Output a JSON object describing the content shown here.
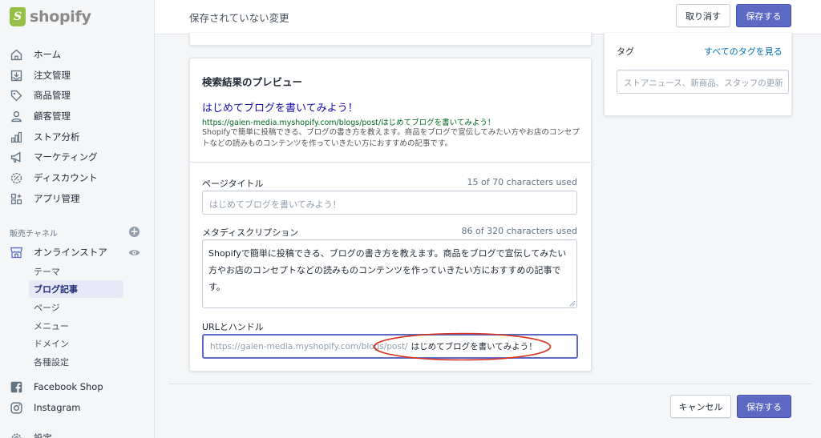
{
  "brand": {
    "name": "shopify",
    "mark": "S",
    "logo_color": "#95bf47"
  },
  "sidebar": {
    "items": [
      {
        "label": "ホーム",
        "icon": "home-icon"
      },
      {
        "label": "注文管理",
        "icon": "inbox-icon"
      },
      {
        "label": "商品管理",
        "icon": "tag-icon"
      },
      {
        "label": "顧客管理",
        "icon": "person-icon"
      },
      {
        "label": "ストア分析",
        "icon": "bar-chart-icon"
      },
      {
        "label": "マーケティング",
        "icon": "megaphone-icon"
      },
      {
        "label": "ディスカウント",
        "icon": "discount-icon"
      },
      {
        "label": "アプリ管理",
        "icon": "apps-icon"
      }
    ],
    "sales_channels_label": "販売チャネル",
    "online_store": {
      "label": "オンラインストア",
      "icon": "store-icon"
    },
    "online_store_subitems": [
      "テーマ",
      "ブログ記事",
      "ページ",
      "メニュー",
      "ドメイン",
      "各種設定"
    ],
    "active_subitem": "ブログ記事",
    "channels": [
      {
        "label": "Facebook Shop",
        "icon": "facebook-icon"
      },
      {
        "label": "Instagram",
        "icon": "instagram-icon"
      }
    ],
    "settings_partial": "設定"
  },
  "topbar": {
    "status": "保存されていない変更",
    "discard_label": "取り消す",
    "save_label": "保存する"
  },
  "seo": {
    "heading": "検索結果のプレビュー",
    "preview_title": "はじめてブログを書いてみよう！",
    "preview_url": "https://gaien-media.myshopify.com/blogs/post/はじめてブログを書いてみよう！",
    "preview_description": "Shopifyで簡単に投稿できる、ブログの書き方を教えます。商品をブログで宣伝してみたい方やお店のコンセプトなどの読みものコンテンツを作っていきたい方におすすめの記事です。",
    "page_title_label": "ページタイトル",
    "page_title_counter": "15 of 70 characters used",
    "page_title_placeholder": "はじめてブログを書いてみよう！",
    "meta_label": "メタディスクリプション",
    "meta_counter": "86 of 320 characters used",
    "meta_value": "Shopifyで簡単に投稿できる、ブログの書き方を教えます。商品をブログで宣伝してみたい方やお店のコンセプトなどの読みものコンテンツを作っていきたい方におすすめの記事です。",
    "url_label": "URLとハンドル",
    "url_prefix": "https://gaien-media.myshopify.com/blogs/post/",
    "url_handle": "はじめてブログを書いてみよう！"
  },
  "tags": {
    "label": "タグ",
    "view_all": "すべてのタグを見る",
    "placeholder": "ストアニュース、新商品、スタッフの更新"
  },
  "footer": {
    "cancel_label": "キャンセル",
    "save_label": "保存する"
  },
  "colors": {
    "primary": "#5c6ac4",
    "link": "#006fbb",
    "serp_title": "#1a0dab",
    "serp_url": "#006621",
    "annotation": "#d9321f"
  }
}
